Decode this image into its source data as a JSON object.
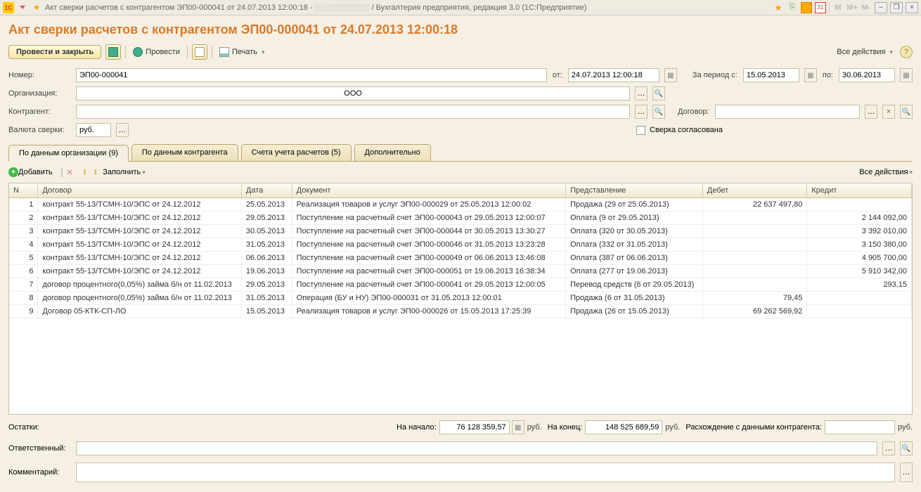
{
  "window": {
    "title": "Акт сверки расчетов с контрагентом ЭП00-000041 от 24.07.2013 12:00:18 -",
    "title_suffix": " / Бухгалтерия предприятия, редакция 3.0   (1С:Предприятие)",
    "memory_labels": [
      "M",
      "M+",
      "M-"
    ]
  },
  "header": {
    "title": "Акт сверки расчетов с контрагентом ЭП00-000041 от 24.07.2013 12:00:18"
  },
  "toolbar": {
    "post_close": "Провести и закрыть",
    "post": "Провести",
    "print": "Печать",
    "all_actions": "Все действия"
  },
  "fields": {
    "number_label": "Номер:",
    "number": "ЭП00-000041",
    "from_label": "от:",
    "date": "24.07.2013 12:00:18",
    "period_from_label": "За период с:",
    "period_from": "15.05.2013",
    "period_to_label": "по:",
    "period_to": "30.06.2013",
    "org_label": "Организация:",
    "org": "ООО",
    "agent_label": "Контрагент:",
    "agent": "",
    "contract_label": "Договор:",
    "contract": "",
    "currency_label": "Валюта сверки:",
    "currency": "руб.",
    "agreed_label": "Сверка согласована"
  },
  "tabs": {
    "org": "По данным организации (9)",
    "agent": "По данным контрагента",
    "accounts": "Счета учета расчетов (5)",
    "extra": "Дополнительно"
  },
  "sub_toolbar": {
    "add": "Добавить",
    "fill": "Заполнить",
    "all_actions": "Все действия"
  },
  "columns": {
    "n": "N",
    "dog": "Договор",
    "date": "Дата",
    "doc": "Документ",
    "rep": "Представление",
    "deb": "Дебет",
    "cred": "Кредит"
  },
  "rows": [
    {
      "n": "1",
      "dog": "контракт 55-13/ТСМН-10/ЭПС от 24.12.2012",
      "date": "25.05.2013",
      "doc": "Реализация товаров и услуг ЭП00-000029 от 25.05.2013 12:00:02",
      "rep": "Продажа (29 от 25.05.2013)",
      "deb": "22 637 497,80",
      "cred": ""
    },
    {
      "n": "2",
      "dog": "контракт 55-13/ТСМН-10/ЭПС от 24.12.2012",
      "date": "29.05.2013",
      "doc": "Поступление на расчетный счет ЭП00-000043 от 29.05.2013 12:00:07",
      "rep": "Оплата (9 от 29.05.2013)",
      "deb": "",
      "cred": "2 144 092,00"
    },
    {
      "n": "3",
      "dog": "контракт 55-13/ТСМН-10/ЭПС от 24.12.2012",
      "date": "30.05.2013",
      "doc": "Поступление на расчетный счет ЭП00-000044 от 30.05.2013 13:30:27",
      "rep": "Оплата (320 от 30.05.2013)",
      "deb": "",
      "cred": "3 392 010,00"
    },
    {
      "n": "4",
      "dog": "контракт 55-13/ТСМН-10/ЭПС от 24.12.2012",
      "date": "31.05.2013",
      "doc": "Поступление на расчетный счет ЭП00-000046 от 31.05.2013 13:23:28",
      "rep": "Оплата (332 от 31.05.2013)",
      "deb": "",
      "cred": "3 150 380,00"
    },
    {
      "n": "5",
      "dog": "контракт 55-13/ТСМН-10/ЭПС от 24.12.2012",
      "date": "06.06.2013",
      "doc": "Поступление на расчетный счет ЭП00-000049 от 06.06.2013 13:46:08",
      "rep": "Оплата (387 от 06.06.2013)",
      "deb": "",
      "cred": "4 905 700,00"
    },
    {
      "n": "6",
      "dog": "контракт 55-13/ТСМН-10/ЭПС от 24.12.2012",
      "date": "19.06.2013",
      "doc": "Поступление на расчетный счет ЭП00-000051 от 19.06.2013 16:38:34",
      "rep": "Оплата (277 от 19.06.2013)",
      "deb": "",
      "cred": "5 910 342,00"
    },
    {
      "n": "7",
      "dog": "договор процентного(0,05%) займа б/н от 11.02.2013",
      "date": "29.05.2013",
      "doc": "Поступление на расчетный счет ЭП00-000041 от 29.05.2013 12:00:05",
      "rep": "Перевод средств (6 от 29.05.2013)",
      "deb": "",
      "cred": "293,15"
    },
    {
      "n": "8",
      "dog": "договор процентного(0,05%) займа б/н от 11.02.2013",
      "date": "31.05.2013",
      "doc": "Операция (БУ и НУ) ЭП00-000031 от 31.05.2013 12:00:01",
      "rep": "Продажа (6 от 31.05.2013)",
      "deb": "79,45",
      "cred": ""
    },
    {
      "n": "9",
      "dog": "Договор 05-КТК-СП-ЛО",
      "date": "15.05.2013",
      "doc": "Реализация товаров и услуг ЭП00-000026 от 15.05.2013 17:25:39",
      "rep": "Продажа (26 от 15.05.2013)",
      "deb": "69 262 569,92",
      "cred": ""
    }
  ],
  "balances": {
    "label": "Остатки:",
    "begin_label": "На начало:",
    "begin": "76 128 359,57",
    "end_label": "На конец:",
    "end": "148 525 689,59",
    "unit": "руб.",
    "diff_label": "Расхождение с данными контрагента:",
    "diff": ""
  },
  "resp": {
    "label": "Ответственный:",
    "value": ""
  },
  "comment": {
    "label": "Комментарий:",
    "value": ""
  }
}
